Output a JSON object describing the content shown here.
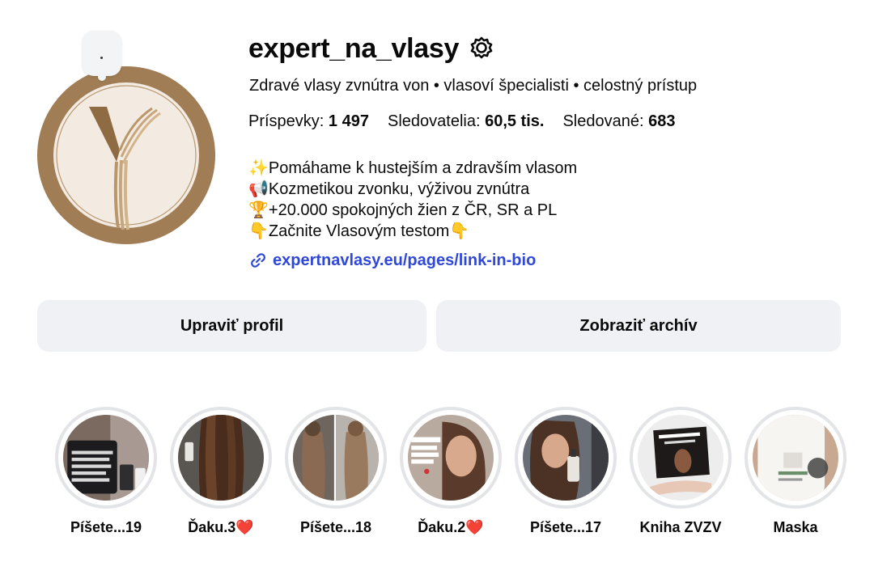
{
  "profile": {
    "username": "expert_na_vlasy",
    "category": "Zdravé vlasy zvnútra von • vlasoví špecialisti • celostný prístup",
    "stats": [
      {
        "label": "Príspevky:",
        "value": "1 497"
      },
      {
        "label": "Sledovatelia:",
        "value": "60,5 tis."
      },
      {
        "label": "Sledované:",
        "value": "683"
      }
    ],
    "bio": [
      "✨Pomáhame k hustejším a zdravším vlasom",
      "📢Kozmetikou zvonku, výživou zvnútra",
      "🏆+20.000 spokojných žien z ČR, SR a PL",
      "👇Začnite Vlasovým testom👇"
    ],
    "link": "expertnavlasy.eu/pages/link-in-bio"
  },
  "buttons": {
    "edit_profile": "Upraviť profil",
    "view_archive": "Zobraziť archív"
  },
  "highlights": [
    {
      "label": "Píšete...19",
      "icon": "chat-screenshot"
    },
    {
      "label": "Ďaku.3❤️",
      "icon": "long-hair-back"
    },
    {
      "label": "Píšete...18",
      "icon": "hair-comparison"
    },
    {
      "label": "Ďaku.2❤️",
      "icon": "woman-portrait"
    },
    {
      "label": "Píšete...17",
      "icon": "woman-with-product"
    },
    {
      "label": "Kniha ZVZV",
      "icon": "book"
    },
    {
      "label": "Maska",
      "icon": "hair-mask-bottle"
    }
  ],
  "colors": {
    "avatar_ring": "#a07d54",
    "link": "#3048d8",
    "button_bg": "#eff1f4",
    "highlight_ring": "#e2e4e8"
  }
}
